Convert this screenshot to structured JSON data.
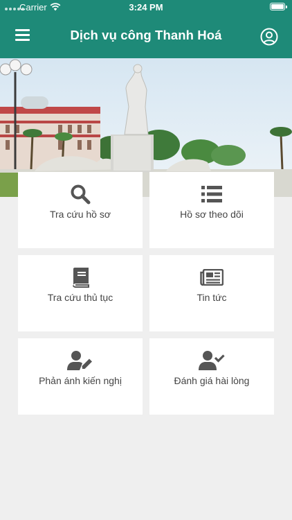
{
  "status_bar": {
    "carrier": "Carrier",
    "time": "3:24 PM"
  },
  "nav": {
    "title": "Dịch vụ công Thanh Hoá",
    "menu_icon": "hamburger-menu-icon",
    "account_icon": "user-circle-icon"
  },
  "colors": {
    "primary": "#1e8a78",
    "icon": "#555555",
    "background": "#efefef",
    "card": "#ffffff"
  },
  "menu": [
    {
      "label": "Tra cứu hồ sơ",
      "icon": "search-icon"
    },
    {
      "label": "Hồ sơ theo dõi",
      "icon": "list-icon"
    },
    {
      "label": "Tra cứu thủ tục",
      "icon": "book-icon"
    },
    {
      "label": "Tin tức",
      "icon": "newspaper-icon"
    },
    {
      "label": "Phản ánh kiến nghị",
      "icon": "user-edit-icon"
    },
    {
      "label": "Đánh giá hài lòng",
      "icon": "user-check-icon"
    }
  ]
}
